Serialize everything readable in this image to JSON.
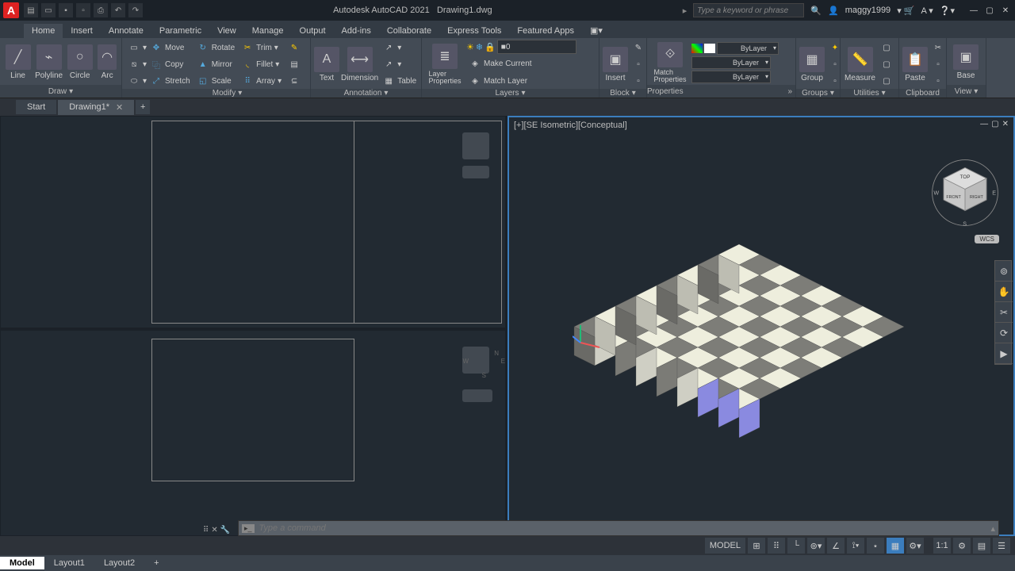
{
  "app": {
    "title": "Autodesk AutoCAD 2021",
    "doc": "Drawing1.dwg",
    "user": "maggy1999",
    "search_placeholder": "Type a keyword or phrase"
  },
  "ribbon_tabs": [
    "Home",
    "Insert",
    "Annotate",
    "Parametric",
    "View",
    "Manage",
    "Output",
    "Add-ins",
    "Collaborate",
    "Express Tools",
    "Featured Apps"
  ],
  "draw": {
    "line": "Line",
    "polyline": "Polyline",
    "circle": "Circle",
    "arc": "Arc",
    "panel": "Draw"
  },
  "modify": {
    "move": "Move",
    "rotate": "Rotate",
    "trim": "Trim",
    "copy": "Copy",
    "mirror": "Mirror",
    "fillet": "Fillet",
    "stretch": "Stretch",
    "scale": "Scale",
    "array": "Array",
    "panel": "Modify"
  },
  "annot": {
    "text": "Text",
    "dimension": "Dimension",
    "table": "Table",
    "panel": "Annotation"
  },
  "layers": {
    "props": "Layer\nProperties",
    "make_current": "Make Current",
    "match_layer": "Match Layer",
    "current": "0",
    "panel": "Layers"
  },
  "block": {
    "insert": "Insert",
    "panel": "Block"
  },
  "props": {
    "match": "Match\nProperties",
    "bylayer1": "ByLayer",
    "bylayer2": "ByLayer",
    "bylayer3": "ByLayer",
    "panel": "Properties"
  },
  "groups": {
    "group": "Group",
    "panel": "Groups"
  },
  "utils": {
    "measure": "Measure",
    "panel": "Utilities"
  },
  "clip": {
    "paste": "Paste",
    "panel": "Clipboard"
  },
  "view": {
    "base": "Base",
    "panel": "View"
  },
  "doc_tabs": {
    "start": "Start",
    "drawing": "Drawing1*"
  },
  "viewport": {
    "label": "[+][SE Isometric][Conceptual]",
    "wcs": "WCS"
  },
  "cmd": {
    "placeholder": "Type a command"
  },
  "status": {
    "model": "MODEL"
  },
  "layout_tabs": [
    "Model",
    "Layout1",
    "Layout2"
  ],
  "viewcube": {
    "top": "TOP",
    "front": "FRONT",
    "right": "RIGHT",
    "w": "W",
    "e": "E",
    "s": "S"
  }
}
